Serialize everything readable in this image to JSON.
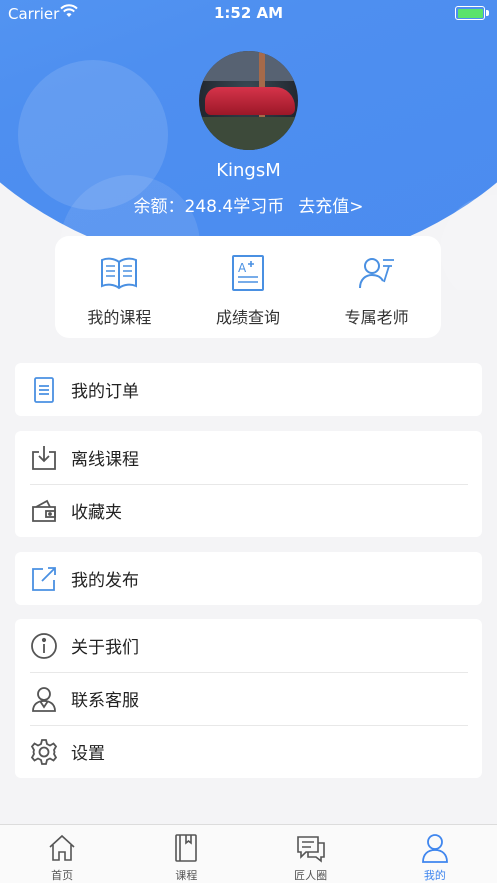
{
  "status_bar": {
    "carrier": "Carrier",
    "time": "1:52 AM"
  },
  "profile": {
    "username": "KingsM",
    "balance_label": "余额：248.4学习币",
    "recharge_label": "去充值>"
  },
  "quick_actions": [
    {
      "label": "我的课程",
      "icon": "book-icon"
    },
    {
      "label": "成绩查询",
      "icon": "grade-doc-icon"
    },
    {
      "label": "专属老师",
      "icon": "teacher-icon"
    }
  ],
  "menu": {
    "orders": "我的订单",
    "offline_courses": "离线课程",
    "favorites": "收藏夹",
    "my_posts": "我的发布",
    "about_us": "关于我们",
    "contact_service": "联系客服",
    "settings": "设置"
  },
  "tabbar": [
    {
      "label": "首页",
      "icon": "home-icon",
      "active": false
    },
    {
      "label": "课程",
      "icon": "course-book-icon",
      "active": false
    },
    {
      "label": "匠人圈",
      "icon": "chat-icon",
      "active": false
    },
    {
      "label": "我的",
      "icon": "person-icon",
      "active": true
    }
  ],
  "colors": {
    "accent": "#4a8bef",
    "icon_blue": "#4a90e2",
    "icon_gray": "#555555",
    "battery": "#5be36b"
  }
}
